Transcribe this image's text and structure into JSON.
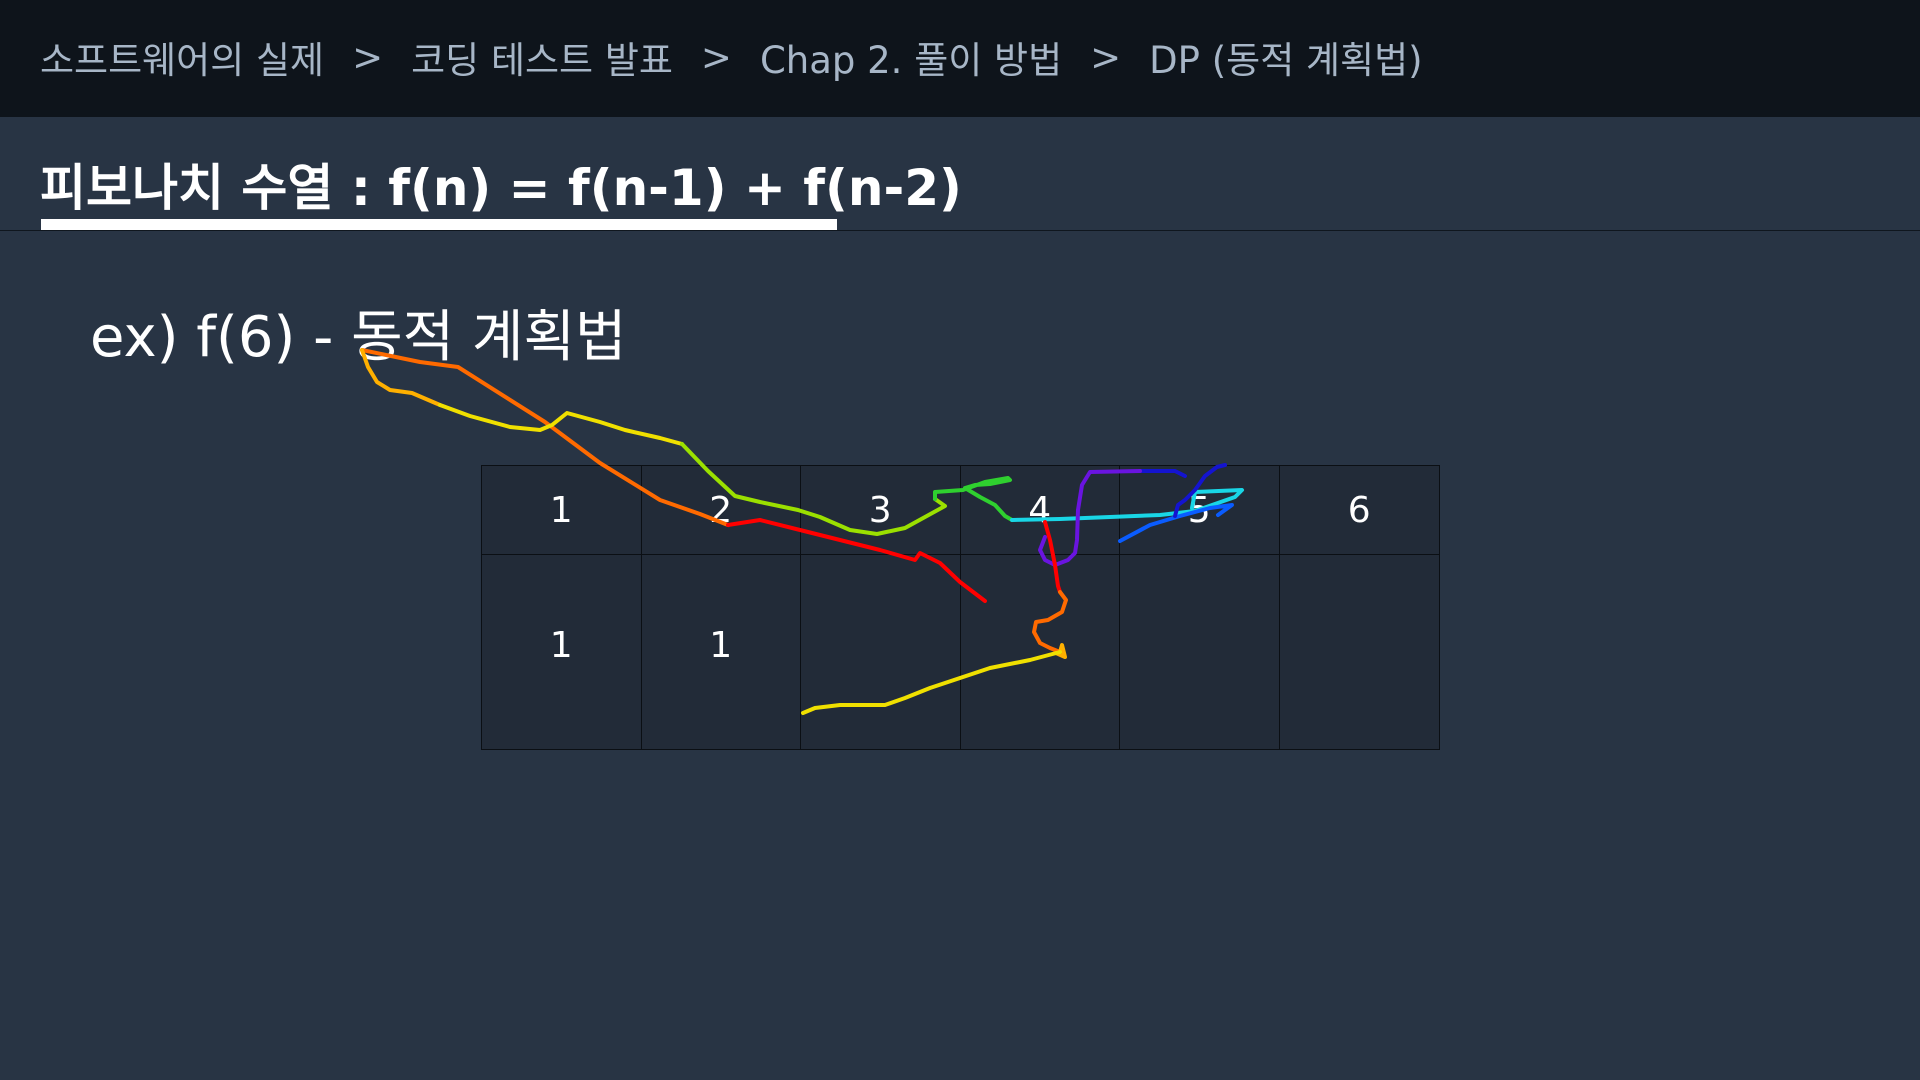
{
  "breadcrumb": {
    "items": [
      "소프트웨어의 실제",
      "코딩 테스트 발표",
      "Chap 2. 풀이 방법",
      "DP (동적 계획법)"
    ],
    "separator": ">"
  },
  "heading": {
    "title": "피보나치 수열 : f(n) = f(n-1) + f(n-2)"
  },
  "example": {
    "text": "ex) f(6) - 동적 계획법"
  },
  "table": {
    "indices": [
      "1",
      "2",
      "3",
      "4",
      "5",
      "6"
    ],
    "values": [
      "1",
      "1",
      "",
      "",
      "",
      ""
    ]
  },
  "colors": {
    "background": "#283444",
    "topbar": "#0e141b",
    "breadcrumb_text": "#a7b6c7",
    "text": "#ffffff",
    "scribble": [
      "#ff0000",
      "#ff6a00",
      "#ffb000",
      "#f0e000",
      "#9be000",
      "#2fd02f",
      "#19d6e6",
      "#0a5cff",
      "#1414d0",
      "#6a14e0"
    ]
  }
}
